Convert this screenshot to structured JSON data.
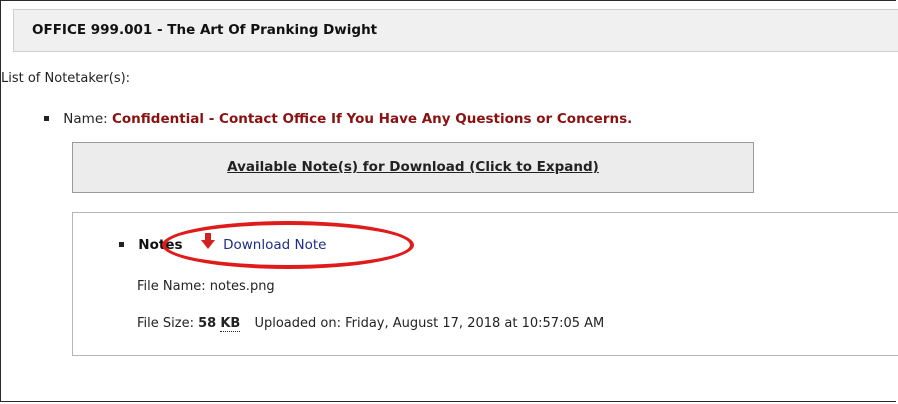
{
  "course": {
    "title": "OFFICE 999.001 - The Art Of Pranking Dwight"
  },
  "notetakers": {
    "label": "List of Notetaker(s):",
    "name_prefix": "Name:",
    "name_value": "Confidential - Contact Office If You Have Any Questions or Concerns."
  },
  "available": {
    "link_label": "Available Note(s) for Download (Click to Expand)"
  },
  "note": {
    "label": "Notes",
    "download_label": "Download Note",
    "download_icon": "red-down-arrow-icon",
    "file_name_text": "File Name: notes.png",
    "file_size_label": "File Size:",
    "file_size_value": "58",
    "file_size_unit": "KB",
    "uploaded_text": "Uploaded on: Friday, August 17, 2018 at 10:57:05 AM"
  },
  "colors": {
    "confidential": "#8b1010",
    "link": "#1f2d8a",
    "highlight": "#e01b1b",
    "icon": "#d32020"
  }
}
